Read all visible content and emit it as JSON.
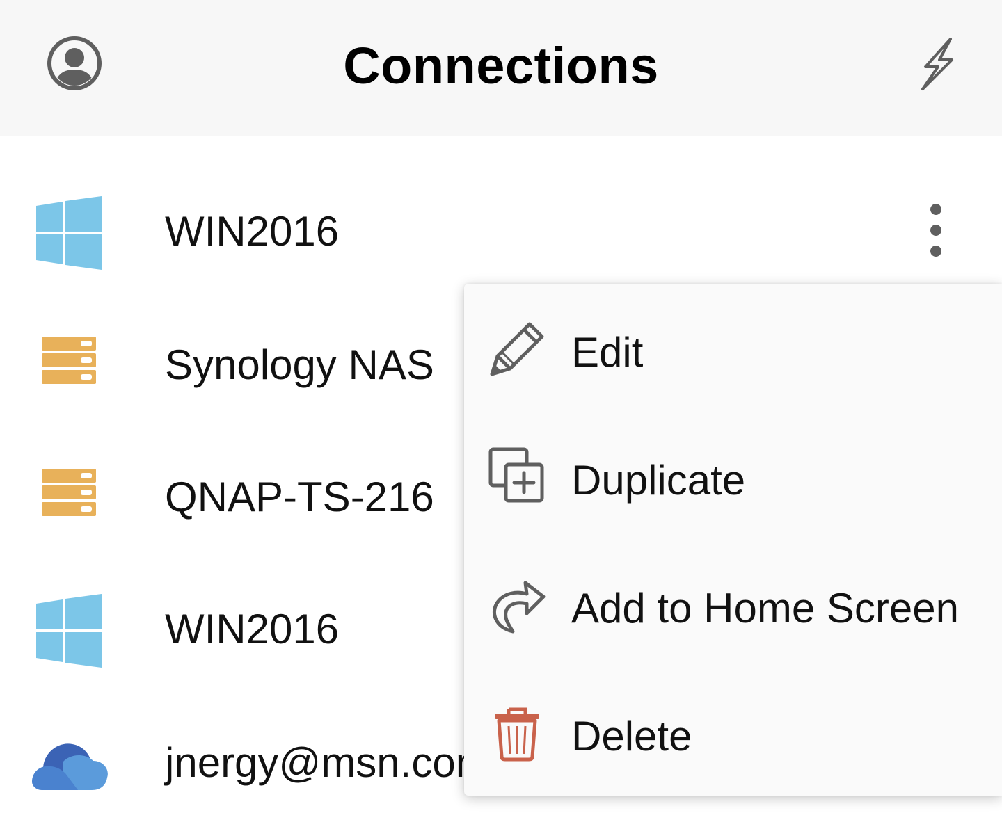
{
  "header": {
    "title": "Connections",
    "left_icon": "account-circle-icon",
    "right_icon": "lightning-bolt-icon"
  },
  "connections": [
    {
      "name": "WIN2016",
      "icon": "windows-logo-icon",
      "color": "#7CC6E8"
    },
    {
      "name": "Synology NAS",
      "icon": "nas-server-icon",
      "color": "#E8B15A"
    },
    {
      "name": "QNAP-TS-216",
      "icon": "nas-server-icon",
      "color": "#E8B15A"
    },
    {
      "name": "WIN2016",
      "icon": "windows-logo-icon",
      "color": "#7CC6E8"
    },
    {
      "name": "jnergy@msn.com",
      "icon": "onedrive-cloud-icon",
      "color": "#4A82CF"
    }
  ],
  "context_menu": {
    "items": [
      {
        "label": "Edit",
        "icon": "pencil-icon"
      },
      {
        "label": "Duplicate",
        "icon": "duplicate-icon"
      },
      {
        "label": "Add to Home Screen",
        "icon": "share-arrow-icon"
      },
      {
        "label": "Delete",
        "icon": "trash-icon",
        "color": "#C9624B"
      }
    ]
  },
  "colors": {
    "header_bg": "#F7F7F7",
    "icon_gray": "#5F5F5F",
    "windows_blue": "#7CC6E8",
    "nas_orange": "#E8B15A",
    "delete_red": "#C9624B"
  }
}
